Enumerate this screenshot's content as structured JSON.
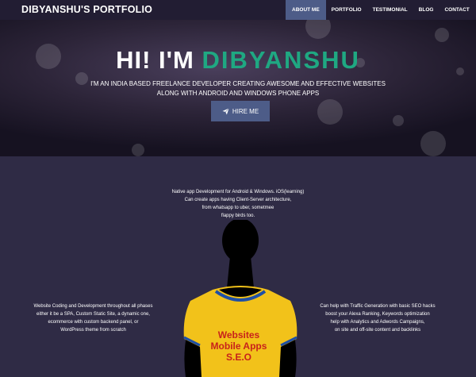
{
  "navbar": {
    "brand": "DIBYANSHU'S PORTFOLIO",
    "items": [
      {
        "label": "ABOUT ME",
        "active": true
      },
      {
        "label": "PORTFOLIO",
        "active": false
      },
      {
        "label": "TESTIMONIAL",
        "active": false
      },
      {
        "label": "BLOG",
        "active": false
      },
      {
        "label": "CONTACT",
        "active": false
      }
    ]
  },
  "hero": {
    "title_prefix": "HI! I'M",
    "title_name": "DIBYANSHU",
    "subtitle_line1": "I'M AN INDIA BASED FREELANCE DEVELOPER CREATING AWESOME AND EFFECTIVE WEBSITES",
    "subtitle_line2": "ALONG WITH ANDROID AND WINDOWS PHONE APPS",
    "hire_button": "HIRE ME",
    "hire_icon": "paper-plane-icon"
  },
  "skills": {
    "top_lines": [
      "Native app Development for Android & Windows. iOS(learning)",
      "Can create apps having Client-Server architecture,",
      "from whatsapp to uber, sometmee",
      "flappy birds too."
    ],
    "left_lines": [
      "Website Coding and Development throughout all phases",
      "either it be a SPA, Custom Static Site, a dynamic one,",
      "ecommerce with custom backend panel, or",
      "WordPress theme from scratch"
    ],
    "right_lines": [
      "Can help with Traffic Generation with basic SEO hacks",
      "boost your Alexa Ranking, Keywords optimization",
      "help with Analytics and Adwords Campaigns,",
      "on site and off-site content and backlinks"
    ],
    "shirt_lines": [
      "Websites",
      "Mobile Apps",
      "S.E.O"
    ]
  },
  "colors": {
    "accent": "#1fa882",
    "nav_active": "#4d5c88",
    "background": "#2f2b45",
    "shirt": "#f2c21a",
    "shirt_text": "#c8221b"
  }
}
